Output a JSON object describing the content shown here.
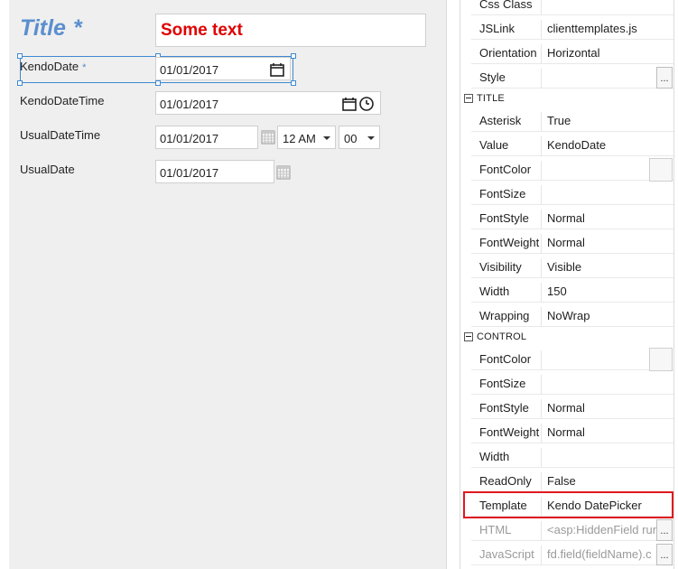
{
  "designer": {
    "title_text": "Title",
    "title_asterisk": "*",
    "text_value": "Some text",
    "rows": [
      {
        "label": "KendoDate",
        "asterisk": "*",
        "value": "01/01/2017"
      },
      {
        "label": "KendoDateTime",
        "value": "01/01/2017"
      },
      {
        "label": "UsualDateTime",
        "value": "01/01/2017",
        "hour": "12 AM",
        "minute": "00"
      },
      {
        "label": "UsualDate",
        "value": "01/01/2017"
      }
    ]
  },
  "properties": {
    "top_rows": [
      {
        "name": "Css Class",
        "value": ""
      },
      {
        "name": "JSLink",
        "value": "clienttemplates.js"
      },
      {
        "name": "Orientation",
        "value": "Horizontal"
      },
      {
        "name": "Style",
        "value": ""
      }
    ],
    "title_category": "TITLE",
    "title_rows": [
      {
        "name": "Asterisk",
        "value": "True"
      },
      {
        "name": "Value",
        "value": "KendoDate"
      },
      {
        "name": "FontColor",
        "value": ""
      },
      {
        "name": "FontSize",
        "value": ""
      },
      {
        "name": "FontStyle",
        "value": "Normal"
      },
      {
        "name": "FontWeight",
        "value": "Normal"
      },
      {
        "name": "Visibility",
        "value": "Visible"
      },
      {
        "name": "Width",
        "value": "150"
      },
      {
        "name": "Wrapping",
        "value": "NoWrap"
      }
    ],
    "control_category": "CONTROL",
    "control_rows": [
      {
        "name": "FontColor",
        "value": ""
      },
      {
        "name": "FontSize",
        "value": ""
      },
      {
        "name": "FontStyle",
        "value": "Normal"
      },
      {
        "name": "FontWeight",
        "value": "Normal"
      },
      {
        "name": "Width",
        "value": ""
      },
      {
        "name": "ReadOnly",
        "value": "False"
      },
      {
        "name": "Template",
        "value": "Kendo DatePicker"
      },
      {
        "name": "HTML",
        "value": "<asp:HiddenField run"
      },
      {
        "name": "JavaScript",
        "value": "fd.field(fieldName).c"
      }
    ],
    "ellipsis_label": "..."
  },
  "icons": [
    "calendar-icon",
    "clock-icon",
    "calendar-grid-icon",
    "chevron-down-icon",
    "collapse-icon"
  ],
  "colors": {
    "title_blue": "#5b8fce",
    "text_red": "#e00000",
    "selection_blue": "#3c8ad1",
    "highlight_red": "#e0191f"
  }
}
